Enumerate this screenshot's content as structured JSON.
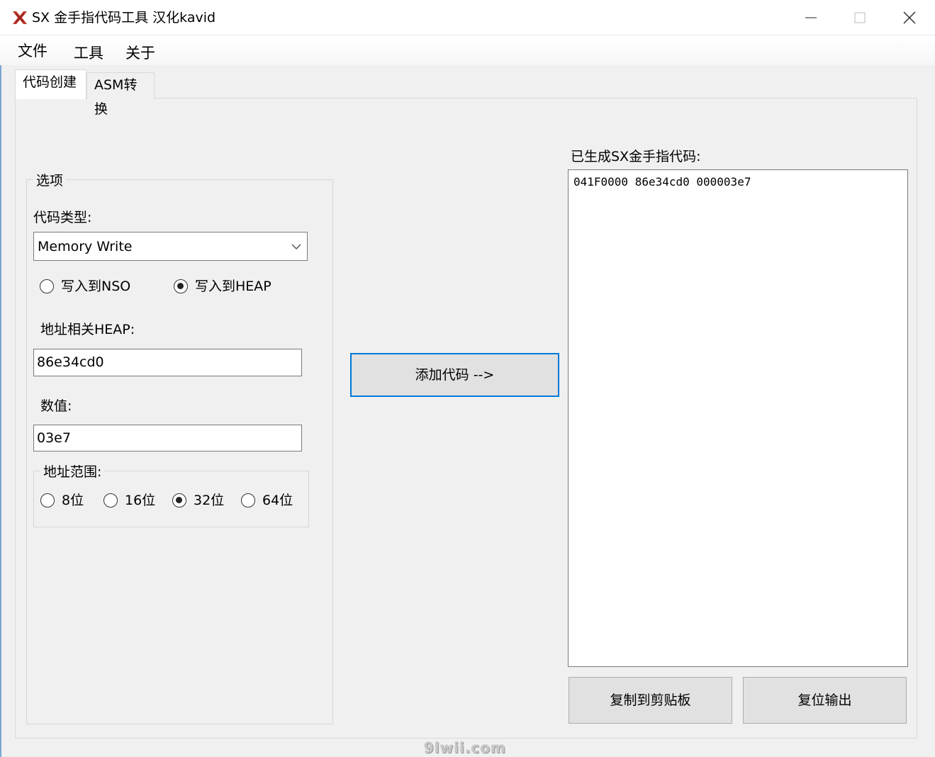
{
  "window": {
    "title": "SX 金手指代码工具 汉化kavid",
    "icon": "sx-logo-icon",
    "controls": [
      "minimize-icon",
      "maximize-icon",
      "close-icon"
    ]
  },
  "menu": {
    "file": "文件",
    "tools": "工具",
    "about": "关于"
  },
  "tabs": [
    {
      "label": "代码创建",
      "active": true
    },
    {
      "label": "ASM转换",
      "active": false
    }
  ],
  "options": {
    "legend": "选项",
    "code_type_label": "代码类型:",
    "code_type_value": "Memory Write",
    "write_nso_label": "写入到NSO",
    "write_heap_label": "写入到HEAP",
    "write_target_selected": "heap",
    "address_label": "地址相关HEAP:",
    "address_value": "86e34cd0",
    "value_label": "数值:",
    "value_value": "03e7",
    "range_legend": "地址范围:",
    "range_8": "8位",
    "range_16": "16位",
    "range_32": "32位",
    "range_64": "64位",
    "range_selected": "32位"
  },
  "add_button_label": "添加代码 -->",
  "output": {
    "label": "已生成SX金手指代码:",
    "text": "041F0000 86e34cd0 000003e7"
  },
  "buttons": {
    "copy": "复制到剪贴板",
    "reset": "复位输出"
  },
  "watermark": "9lwii.com",
  "colors": {
    "accent": "#0078d7",
    "window_bg": "#f0f0f0"
  }
}
